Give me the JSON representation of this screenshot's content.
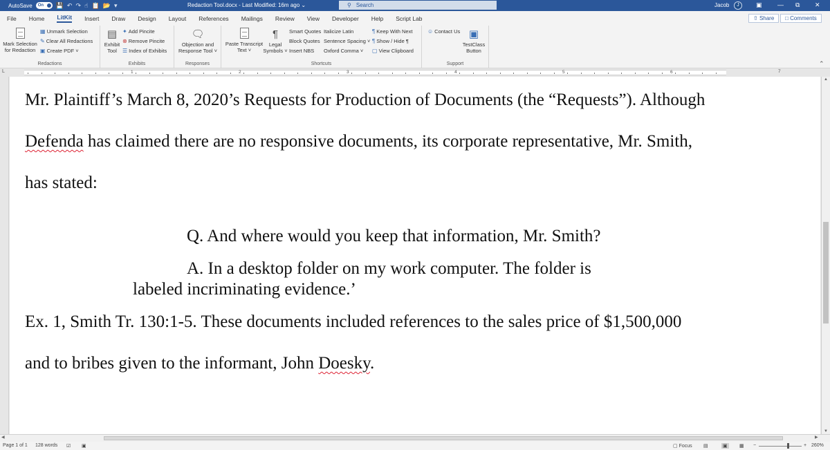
{
  "titlebar": {
    "autosave_label": "AutoSave",
    "autosave_state": "On",
    "doc_title": "Redaction Tool.docx  -  Last Modified: 16m ago  ⌄",
    "search_placeholder": "Search",
    "user_name": "Jacob",
    "user_initial": "J"
  },
  "tabs": [
    "File",
    "Home",
    "LitKit",
    "Insert",
    "Draw",
    "Design",
    "Layout",
    "References",
    "Mailings",
    "Review",
    "View",
    "Developer",
    "Help",
    "Script Lab"
  ],
  "share_label": "Share",
  "comments_label": "Comments",
  "ribbon": {
    "redactions": {
      "mark_selection": "Mark Selection",
      "for_redaction": "for Redaction",
      "unmark_selection": "Unmark Selection",
      "clear_all": "Clear All Redactions",
      "create_pdf": "Create PDF ˅",
      "label": "Redactions"
    },
    "exhibits": {
      "exhibit": "Exhibit",
      "tool": "Tool",
      "add_pincite": "Add Pincite",
      "remove_pincite": "Remove Pincite",
      "index_exhibits": "Index of Exhibits",
      "label": "Exhibits"
    },
    "responses": {
      "objection": "Objection and",
      "response_tool": "Response Tool ˅",
      "label": "Responses"
    },
    "shortcuts": {
      "paste_transcript": "Paste Transcript",
      "text": "Text ˅",
      "legal": "Legal",
      "symbols": "Symbols ˅",
      "smart_quotes": "Smart Quotes",
      "block_quotes": "Block Quotes",
      "insert_nbs": "Insert NBS",
      "italicize_latin": "Italicize Latin",
      "sentence_spacing": "Sentence Spacing ˅",
      "oxford_comma": "Oxford Comma ˅",
      "keep_with_next": "Keep With Next",
      "show_hide": "Show / Hide ¶",
      "view_clipboard": "View Clipboard",
      "label": "Shortcuts"
    },
    "support": {
      "contact_us": "Contact Us",
      "testclass": "TestClass",
      "button": "Button",
      "label": "Support"
    }
  },
  "ruler_numbers": [
    "1",
    "2",
    "3",
    "4",
    "5",
    "6",
    "7"
  ],
  "document": {
    "l1": "Mr. Plaintiff’s March 8, 2020’s Requests for Production of Documents (the “Requests”).  Although",
    "l2_word": "Defenda",
    "l2_rest": " has claimed there are no responsive documents, its corporate representative, Mr. Smith,",
    "l3": "has stated:",
    "q": "Q.  And where would you keep that information, Mr. Smith?",
    "a1": "A.  In a desktop folder on my work computer.  The folder is",
    "a2": "labeled incriminating evidence.’",
    "l4": "Ex. 1, Smith Tr. 130:1-5.  These documents included references to the sales price of $1,500,000",
    "l5_pre": "and to bribes given to the informant, John ",
    "l5_word": "Doesky",
    "l5_post": "."
  },
  "status": {
    "page": "Page 1 of 1",
    "words": "128 words",
    "focus": "Focus",
    "zoom": "260%"
  }
}
